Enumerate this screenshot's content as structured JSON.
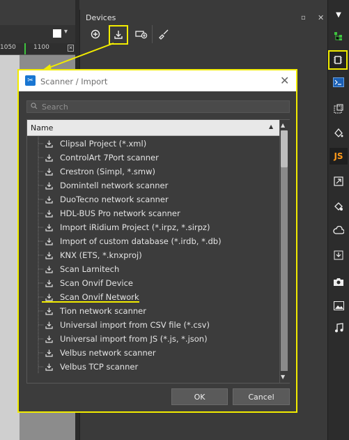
{
  "ruler": {
    "marks": [
      "1050",
      "1100"
    ]
  },
  "devices_panel": {
    "title": "Devices",
    "toolbar": [
      {
        "icon": "add-circle-icon"
      },
      {
        "icon": "import-icon"
      },
      {
        "icon": "device-add-icon"
      },
      {
        "icon": "clear-icon"
      }
    ]
  },
  "right_bar": [
    {
      "icon": "tree-icon"
    },
    {
      "icon": "devices-icon"
    },
    {
      "icon": "terminal-icon"
    },
    {
      "icon": "resize-icon"
    },
    {
      "icon": "paint-icon"
    },
    {
      "label": "JS"
    },
    {
      "icon": "expand-icon"
    },
    {
      "icon": "paint-settings-icon"
    },
    {
      "icon": "cloud-icon"
    },
    {
      "icon": "download-icon"
    },
    {
      "icon": "camera-icon"
    },
    {
      "icon": "image-icon"
    },
    {
      "icon": "music-icon"
    }
  ],
  "dialog": {
    "title": "Scanner / Import",
    "search_placeholder": "Search",
    "column_header": "Name",
    "items": [
      "Clipsal Project (*.xml)",
      "ControlArt 7Port scanner",
      "Crestron (Simpl, *.smw)",
      "Domintell network scanner",
      "DuoTecno network scanner",
      "HDL-BUS Pro network scanner",
      "Import iRidium Project (*.irpz, *.sirpz)",
      "Import of custom database (*.irdb, *.db)",
      "KNX (ETS, *.knxproj)",
      "Scan Larnitech",
      "Scan Onvif Device",
      "Scan Onvif Network",
      "Tion network scanner",
      "Universal import from CSV file (*.csv)",
      "Universal import from JS (*.js, *.json)",
      "Velbus network scanner",
      "Velbus TCP scanner"
    ],
    "ok_label": "OK",
    "cancel_label": "Cancel"
  },
  "colors": {
    "highlight": "#f2ec00",
    "accent_js": "#ff9a1a",
    "accent_green": "#3ec43e"
  }
}
